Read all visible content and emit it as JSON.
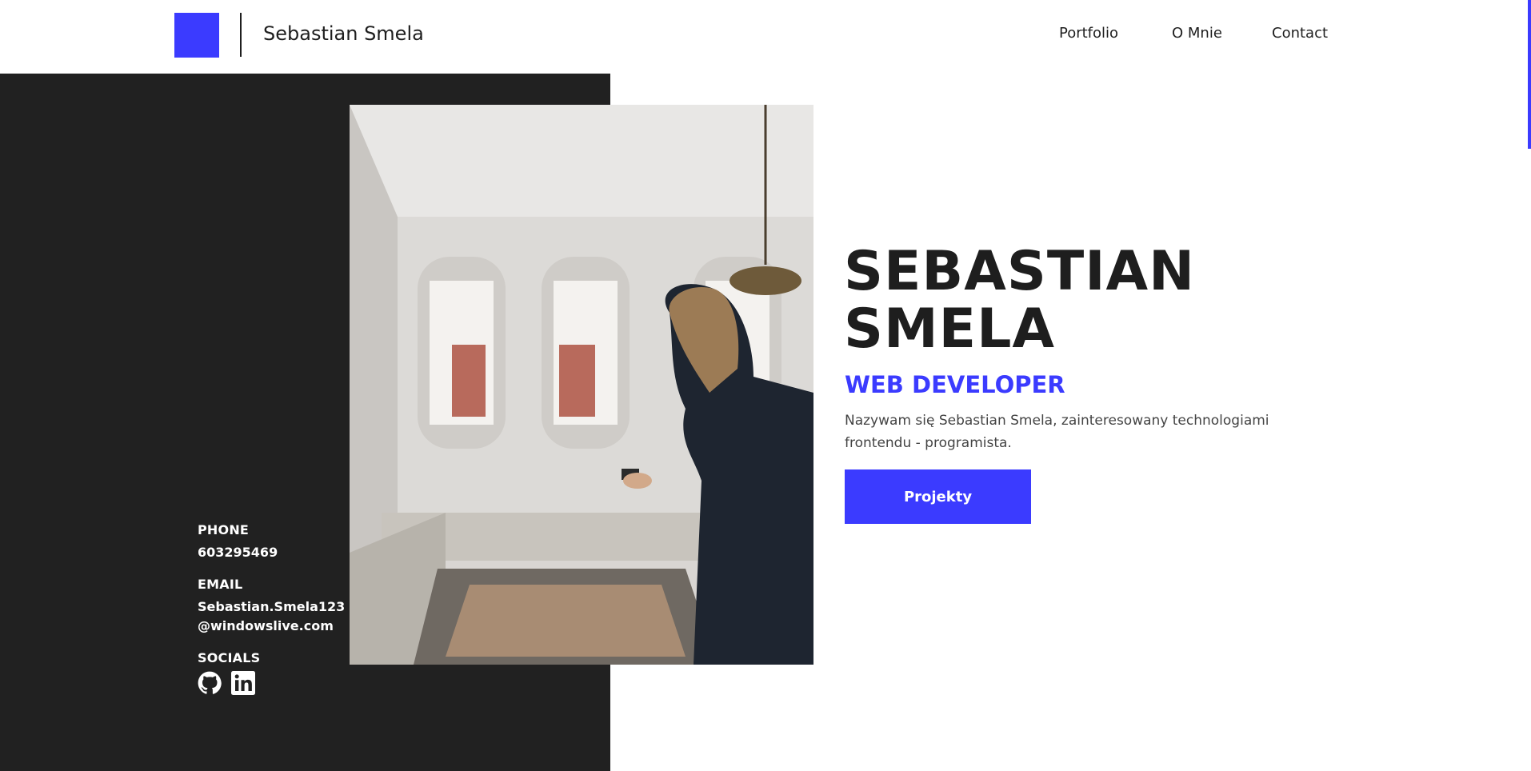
{
  "header": {
    "brand_name": "Sebastian Smela",
    "nav": [
      "Portfolio",
      "O Mnie",
      "Contact"
    ]
  },
  "hero": {
    "title_line1": "SEBASTIAN",
    "title_line2": "SMELA",
    "subtitle": "WEB DEVELOPER",
    "description": "Nazywam się Sebastian Smela, zainteresowany technologiami frontendu - programista.",
    "cta_label": "Projekty"
  },
  "contact": {
    "phone_label": "PHONE",
    "phone_value": "603295469",
    "email_label": "EMAIL",
    "email_line1": "Sebastian.Smela123",
    "email_line2": "@windowslive.com",
    "socials_label": "SOCIALS",
    "socials": [
      "github-icon",
      "linkedin-icon"
    ]
  },
  "colors": {
    "accent": "#3b3bff",
    "dark_panel": "#212121",
    "text": "#1e1e1e"
  }
}
